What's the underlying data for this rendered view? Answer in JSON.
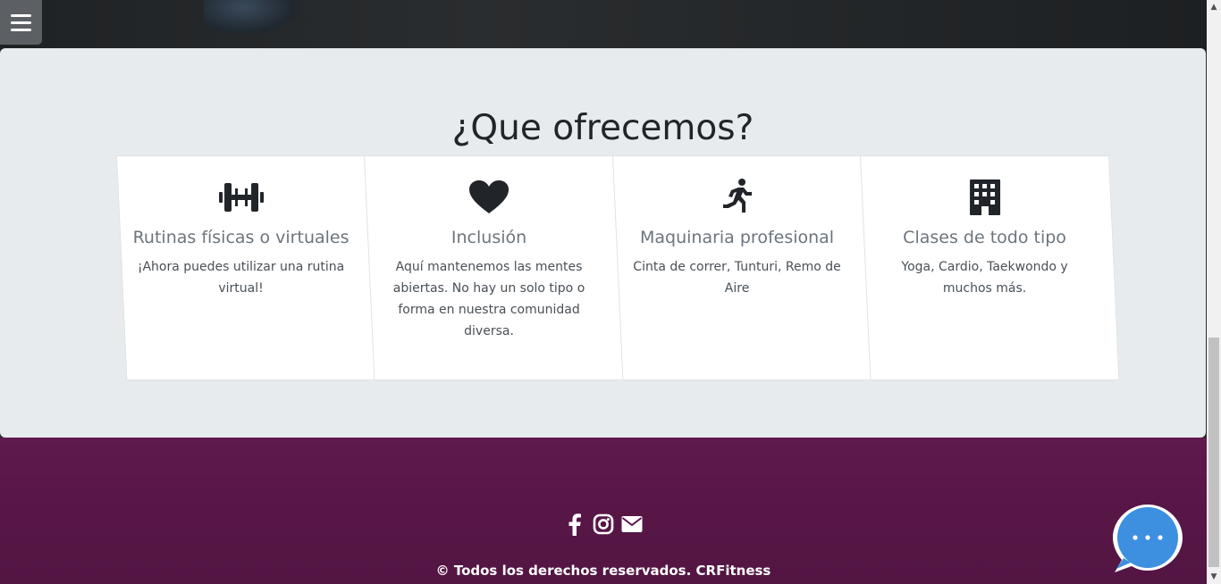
{
  "menu": {
    "icon": "hamburger-menu-icon"
  },
  "offer": {
    "title": "¿Que ofrecemos?",
    "cards": [
      {
        "icon": "dumbbell-icon",
        "title": "Rutinas físicas o virtuales",
        "text": "¡Ahora puedes utilizar una rutina virtual!"
      },
      {
        "icon": "heart-icon",
        "title": "Inclusión",
        "text": "Aquí mantenemos las mentes abiertas. No hay un solo tipo o forma en nuestra comunidad diversa."
      },
      {
        "icon": "running-person-icon",
        "title": "Maquinaria profesional",
        "text": "Cinta de correr, Tunturi, Remo de Aire"
      },
      {
        "icon": "building-icon",
        "title": "Clases de todo tipo",
        "text": "Yoga, Cardio, Taekwondo y muchos más."
      }
    ]
  },
  "footer": {
    "social_icons": [
      "facebook-icon",
      "instagram-icon",
      "envelope-icon"
    ],
    "copyright": "© Todos los derechos reservados. CRFitness"
  },
  "chat": {
    "icon": "chat-bubble-icon"
  },
  "colors": {
    "section_bg": "#e8ebee",
    "card_bg": "#ffffff",
    "title": "#212529",
    "card_title": "#6c757d",
    "footer_bg": "#5a1748",
    "chat_blue": "#3d8fe0"
  }
}
